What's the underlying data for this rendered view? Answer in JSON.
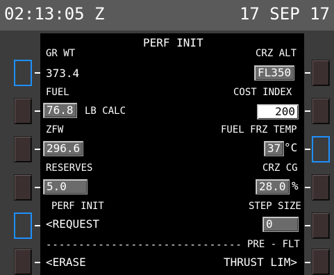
{
  "header": {
    "time": "02:13:05 Z",
    "date": "17 SEP 17"
  },
  "page": {
    "title": "PERF INIT"
  },
  "left": {
    "gr_wt_label": "GR  WT",
    "gr_wt_value": "373.4",
    "fuel_label": "FUEL",
    "fuel_value": "76.8",
    "fuel_suffix": "LB CALC",
    "zfw_label": "ZFW",
    "zfw_value": "296.6",
    "reserves_label": "RESERVES",
    "reserves_value": "5.0",
    "perf_init_label": "PERF INIT",
    "request_label": "<REQUEST",
    "erase_label": "<ERASE"
  },
  "right": {
    "crz_alt_label": "CRZ ALT",
    "crz_alt_value": "FL350",
    "cost_index_label": "COST INDEX",
    "cost_index_value": "200",
    "fuel_frz_temp_label": "FUEL FRZ TEMP",
    "fuel_frz_temp_value": "37",
    "fuel_frz_temp_unit": "°C",
    "crz_cg_label": "CRZ CG",
    "crz_cg_value": "28.0",
    "crz_cg_unit": "%",
    "step_size_label": "STEP SIZE",
    "step_size_value": "0",
    "pre_flt_label": "PRE - FLT",
    "thrust_lim_label": "THRUST LIM>"
  },
  "divider": "------------------------------",
  "colors": {
    "accent": "#1e90ff",
    "field_gray": "#6b6b6b"
  }
}
